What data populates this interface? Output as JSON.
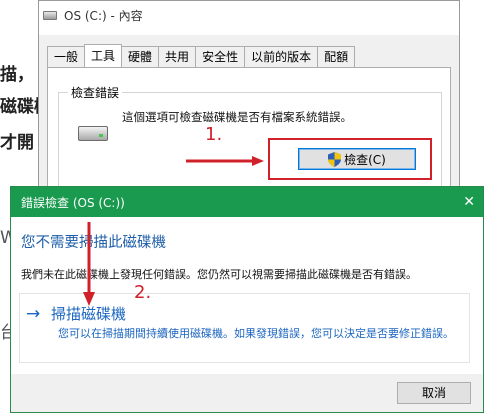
{
  "background_fragments": [
    "描，",
    "磁碟機",
    "才開",
    "W",
    "台"
  ],
  "properties_window": {
    "title": "OS (C:) - 內容",
    "tabs": [
      "一般",
      "工具",
      "硬體",
      "共用",
      "安全性",
      "以前的版本",
      "配額"
    ],
    "active_tab": "工具",
    "group_label": "檢查錯誤",
    "description": "這個選項可檢查磁碟機是否有檔案系統錯誤。",
    "check_button_label": "檢查(C)"
  },
  "annotations": {
    "step1": "1.",
    "step2": "2.",
    "accent_color": "#d0202a"
  },
  "error_check_dialog": {
    "title": "錯誤檢查 (OS (C:))",
    "heading": "您不需要掃描此磁碟機",
    "description": "我們未在此磁碟機上發現任何錯誤。您仍然可以視需要掃描此磁碟機是否有錯誤。",
    "scan_option_title": "掃描磁碟機",
    "scan_option_description": "您可以在掃描期間持續使用磁碟機。如果發現錯誤，您可以決定是否要修正錯誤。",
    "cancel_button_label": "取消",
    "title_bar_color": "#1a9a4f",
    "link_color": "#1c66c1"
  }
}
